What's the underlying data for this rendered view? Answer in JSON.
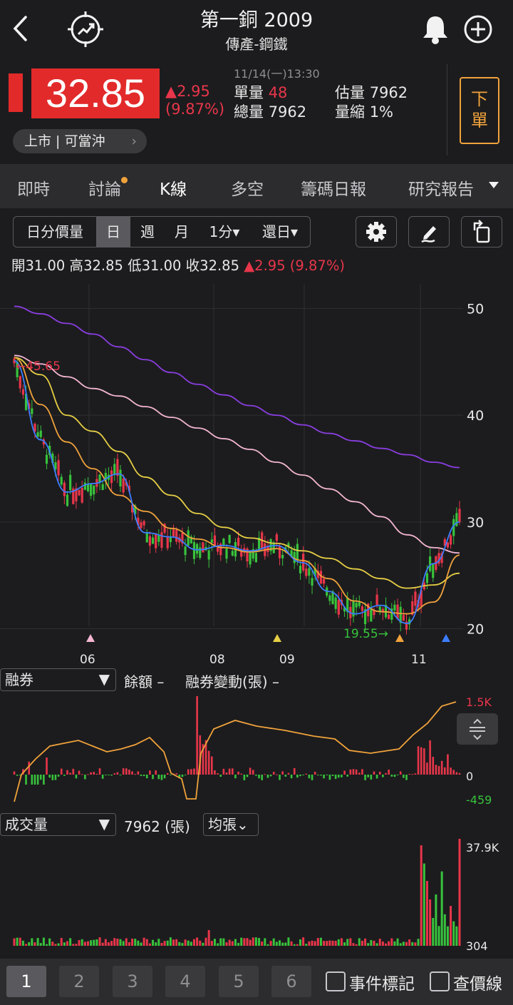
{
  "header": {
    "title": "第一銅 2009",
    "subtitle": "傳產-鋼鐵"
  },
  "icons": {
    "back": "chevron-left-icon",
    "trend": "trend-target-icon",
    "bell": "bell-icon",
    "add": "plus-circle-icon"
  },
  "quote": {
    "price": "32.85",
    "change": "▲2.95",
    "change_pct": "(9.87%)",
    "datetime": "11/14(一)13:30",
    "unit_volume_label": "單量",
    "unit_volume": "48",
    "total_volume_label": "總量",
    "total_volume": "7962",
    "est_volume_label": "估量",
    "est_volume": "7962",
    "volume_ratio_label": "量縮",
    "volume_ratio": "1%",
    "market_chip": "上市 | 可當沖",
    "order_button": "下單"
  },
  "tabs": [
    {
      "label": "即時"
    },
    {
      "label": "討論"
    },
    {
      "label": "K線"
    },
    {
      "label": "多空"
    },
    {
      "label": "籌碼日報"
    },
    {
      "label": "研究報告"
    }
  ],
  "toolbar": {
    "period_items": [
      "日分價量",
      "日",
      "週",
      "月",
      "1分▾",
      "還日▾"
    ],
    "selected": "日"
  },
  "ohlc": {
    "open_label": "開",
    "open": "31.00",
    "high_label": "高",
    "high": "32.85",
    "low_label": "低",
    "low": "31.00",
    "close_label": "收",
    "close": "32.85",
    "change": "▲2.95 (9.87%)"
  },
  "colors": {
    "up": "#e8364a",
    "down": "#38c23c",
    "ma5": "#3c7dff",
    "ma10": "#f0a23b",
    "ma20": "#e6cf45",
    "ma60": "#f4b6d2",
    "ma120": "#8a3ee0"
  },
  "chart_data": [
    {
      "type": "candlestick",
      "y_ticks": [
        50,
        40,
        30,
        20
      ],
      "ylim": [
        18.9,
        52.3
      ],
      "x_ticks": [
        "06",
        "08",
        "09",
        "11"
      ],
      "annotations": [
        {
          "label": "←45.65",
          "value": 45.65
        },
        {
          "label": "19.55→",
          "value": 19.55
        }
      ],
      "ma_lines": [
        {
          "color": "ma120",
          "values": [
            50.2,
            49.5,
            48.6,
            47.6,
            46.4,
            45.2,
            44.0,
            42.9,
            41.9,
            40.9,
            40.0,
            39.1,
            38.3,
            37.6,
            36.9,
            36.3,
            35.6,
            35.1
          ]
        },
        {
          "color": "ma60",
          "values": [
            45.6,
            44.8,
            43.6,
            42.5,
            41.8,
            40.8,
            39.8,
            38.8,
            37.8,
            36.8,
            35.6,
            34.4,
            33.1,
            31.9,
            30.5,
            28.8,
            27.6,
            27.1
          ]
        },
        {
          "color": "ma20",
          "values": [
            45.4,
            43.8,
            40.0,
            38.5,
            36.6,
            34.2,
            32.5,
            30.8,
            29.5,
            28.5,
            28.0,
            27.3,
            26.6,
            25.6,
            24.7,
            23.8,
            24.1,
            25.2
          ]
        },
        {
          "color": "ma10",
          "values": [
            45.4,
            41.0,
            37.5,
            35.0,
            32.5,
            31.0,
            29.4,
            28.4,
            27.6,
            27.2,
            27.5,
            26.4,
            24.7,
            22.6,
            21.6,
            21.4,
            22.5,
            26.9
          ]
        },
        {
          "color": "ma5",
          "values": [
            45.1,
            37.7,
            32.8,
            33.6,
            34.5,
            29.0,
            28.6,
            27.4,
            27.8,
            27.3,
            27.8,
            26.2,
            23.5,
            21.4,
            22.2,
            20.5,
            26.1,
            30.0
          ]
        }
      ]
    },
    {
      "type": "bar",
      "name": "融券",
      "ylabels": [
        "1.5K",
        "0",
        "-459"
      ],
      "ylim": [
        -459,
        1500
      ]
    },
    {
      "type": "bar",
      "name": "成交量",
      "ylabels": [
        "37.9K",
        "304"
      ],
      "ylim": [
        304,
        37900
      ]
    }
  ],
  "short_panel": {
    "selector": "融券",
    "balance_label": "餘額 –",
    "change_label": "融券變動(張) –"
  },
  "volume_panel": {
    "selector": "成交量",
    "value": "7962 (張)",
    "avg_button": "均張⌄"
  },
  "footer": {
    "pages": [
      "1",
      "2",
      "3",
      "4",
      "5",
      "6"
    ],
    "event_label": "事件標記",
    "price_line_label": "查價線"
  }
}
